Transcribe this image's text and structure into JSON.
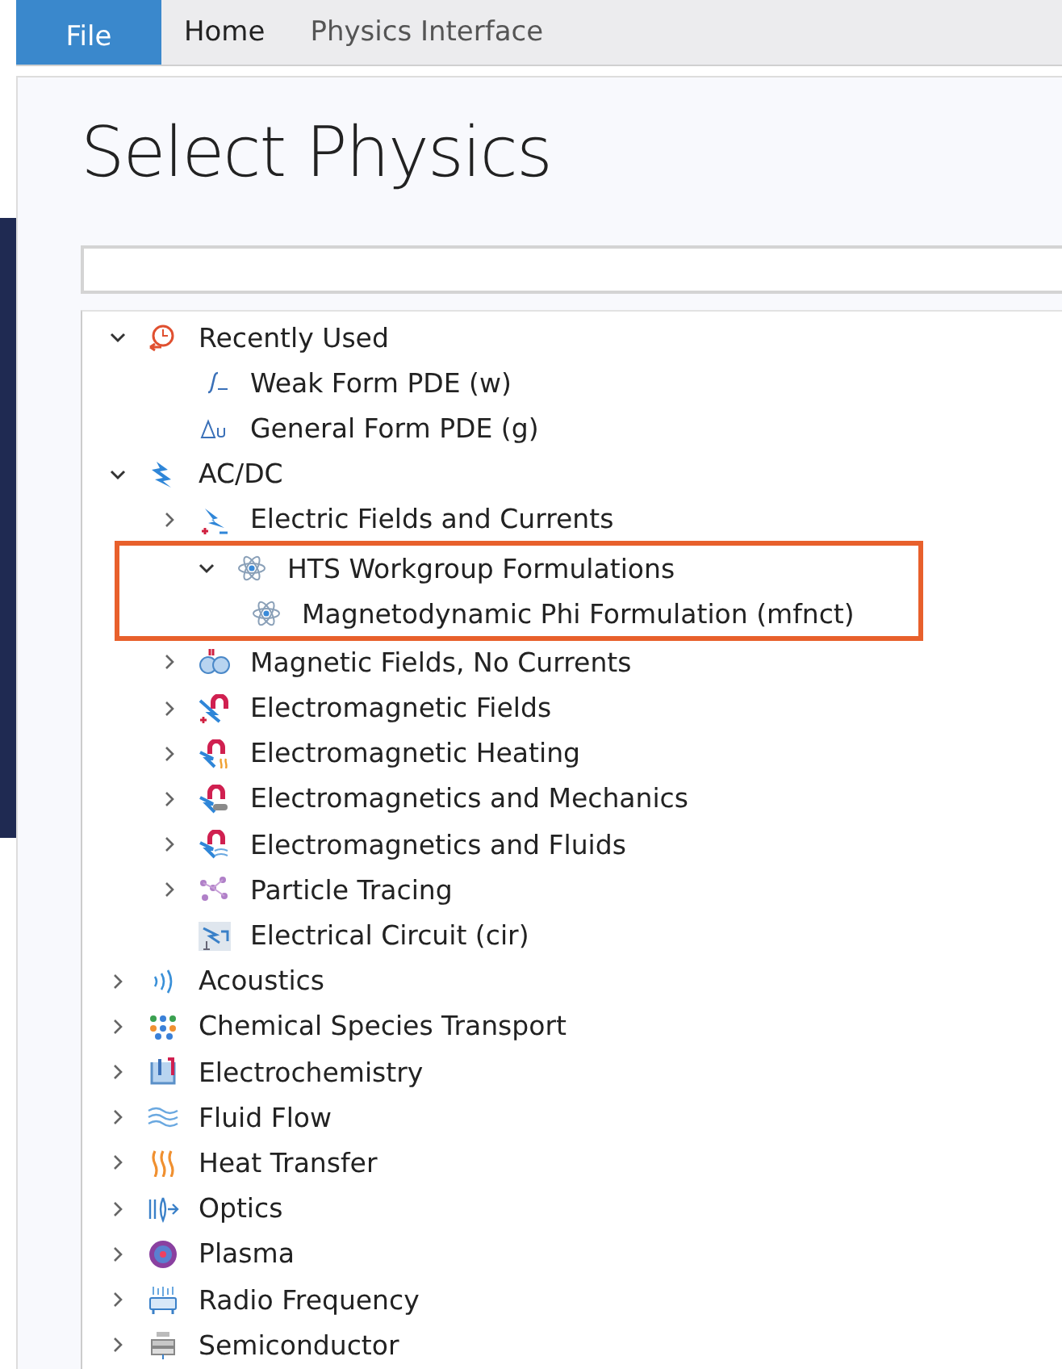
{
  "ribbon_tabs": [
    {
      "label": "File",
      "selected": true,
      "kind": "file"
    },
    {
      "label": "Home",
      "selected": false,
      "kind": "tab"
    },
    {
      "label": "Physics Interface",
      "selected": false,
      "kind": "tab"
    }
  ],
  "title": "Select Physics",
  "tree": [
    {
      "label": "Recently Used",
      "kind": "clock",
      "expanded": true,
      "children": [
        {
          "label": "Weak Form PDE (w)",
          "kind": "integral"
        },
        {
          "label": "General Form PDE (g)",
          "kind": "delta"
        }
      ]
    },
    {
      "label": "AC/DC",
      "kind": "bolt",
      "expanded": true,
      "children": [
        {
          "label": "Electric Fields and Currents",
          "kind": "electric",
          "expanded": false
        },
        {
          "label": "HTS Workgroup Formulations",
          "kind": "atom",
          "expanded": true,
          "highlighted": true,
          "children": [
            {
              "label": "Magnetodynamic Phi Formulation (mfnct)",
              "kind": "atom"
            }
          ]
        },
        {
          "label": "Magnetic Fields, No Currents",
          "kind": "coils",
          "expanded": false
        },
        {
          "label": "Electromagnetic Fields",
          "kind": "magnet",
          "expanded": false
        },
        {
          "label": "Electromagnetic Heating",
          "kind": "magnet-heat",
          "expanded": false
        },
        {
          "label": "Electromagnetics and Mechanics",
          "kind": "magnet-mech",
          "expanded": false
        },
        {
          "label": "Electromagnetics and Fluids",
          "kind": "magnet-fluid",
          "expanded": false
        },
        {
          "label": "Particle Tracing",
          "kind": "particles",
          "expanded": false
        },
        {
          "label": "Electrical Circuit (cir)",
          "kind": "circuit"
        }
      ]
    },
    {
      "label": "Acoustics",
      "kind": "waves",
      "expanded": false
    },
    {
      "label": "Chemical Species Transport",
      "kind": "dots",
      "expanded": false
    },
    {
      "label": "Electrochemistry",
      "kind": "beaker",
      "expanded": false
    },
    {
      "label": "Fluid Flow",
      "kind": "flow",
      "expanded": false
    },
    {
      "label": "Heat Transfer",
      "kind": "heat",
      "expanded": false
    },
    {
      "label": "Optics",
      "kind": "lens",
      "expanded": false
    },
    {
      "label": "Plasma",
      "kind": "plasma",
      "expanded": false
    },
    {
      "label": "Radio Frequency",
      "kind": "antenna",
      "expanded": false
    },
    {
      "label": "Semiconductor",
      "kind": "chip",
      "expanded": false
    }
  ]
}
